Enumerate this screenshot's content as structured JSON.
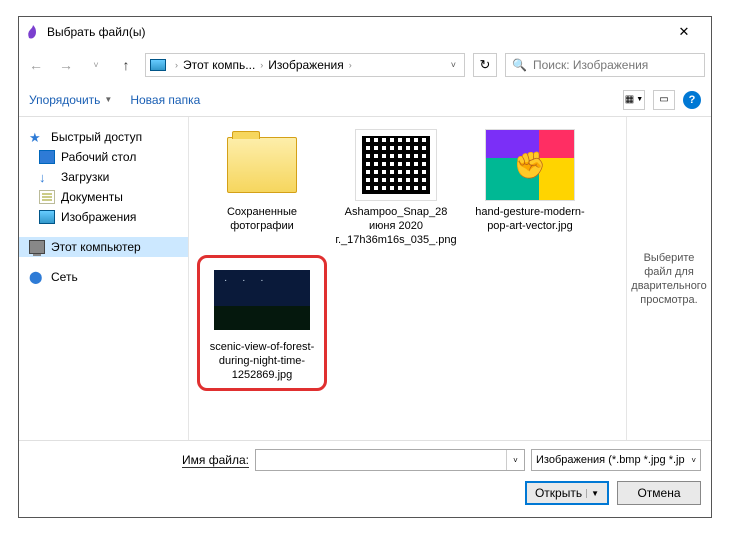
{
  "window": {
    "title": "Выбрать файл(ы)"
  },
  "breadcrumb": {
    "pc": "Этот компь...",
    "folder": "Изображения"
  },
  "search": {
    "placeholder": "Поиск: Изображения"
  },
  "toolbar": {
    "organize": "Упорядочить",
    "new_folder": "Новая папка"
  },
  "sidebar": {
    "quick": "Быстрый доступ",
    "desktop": "Рабочий стол",
    "downloads": "Загрузки",
    "documents": "Документы",
    "pictures": "Изображения",
    "this_pc": "Этот компьютер",
    "network": "Сеть"
  },
  "files": {
    "f0": "Сохраненные фотографии",
    "f1": "Ashampoo_Snap_28 июня 2020 г._17h36m16s_035_.png",
    "f2": "hand-gesture-modern-pop-art-vector.jpg",
    "f3": "scenic-view-of-forest-during-night-time-1252869.jpg"
  },
  "preview": {
    "text": "Выберите файл для дварительного просмотра."
  },
  "footer": {
    "filename_label": "Имя файла:",
    "filetype": "Изображения (*.bmp *.jpg *.jp",
    "open": "Открыть",
    "cancel": "Отмена"
  }
}
